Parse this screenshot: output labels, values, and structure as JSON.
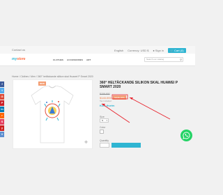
{
  "topbar": {
    "contact": "Contact us",
    "language": "English",
    "currency": "Currency: USD $",
    "signin": "Sign in",
    "cart": "Cart (0)"
  },
  "header": {
    "logo_main": "my",
    "logo_store": "store",
    "nav": [
      "CLOTHES",
      "ACCESSORIES",
      "ART"
    ],
    "search_placeholder": "Search our catalog"
  },
  "breadcrumb": "Home  /  Clothes  /  Men  /  360° heltäckande silikon skal Huawei P Smart 2020",
  "social": [
    {
      "label": "f",
      "color": "#3b5998"
    },
    {
      "label": "t",
      "color": "#55acee"
    },
    {
      "label": "G",
      "color": "#dd4b39"
    },
    {
      "label": "P",
      "color": "#cb2027"
    },
    {
      "label": "in",
      "color": "#007bb6"
    },
    {
      "label": "r",
      "color": "#ff6600"
    },
    {
      "label": "S",
      "color": "#e4405f"
    },
    {
      "label": "y",
      "color": "#cd201f"
    },
    {
      "label": "V",
      "color": "#5d8fd0"
    }
  ],
  "product": {
    "badge": "NEW",
    "title": "360° HELTÄCKANDE SILIKON SKAL HUAWEI P SMART 2020",
    "old_price": "$159.900",
    "new_price": "$143.000",
    "discount": "SAVE 10%",
    "tax_note": "Tax included",
    "size_chart": "Kích thước",
    "size_label": "Size",
    "size_value": "S",
    "color_label": "Color",
    "quantity_label": "Quantity"
  },
  "colors": {
    "accent": "#2fb5d2",
    "sale": "#f39d72",
    "whatsapp": "#25d366",
    "arrow": "#e8202a"
  }
}
